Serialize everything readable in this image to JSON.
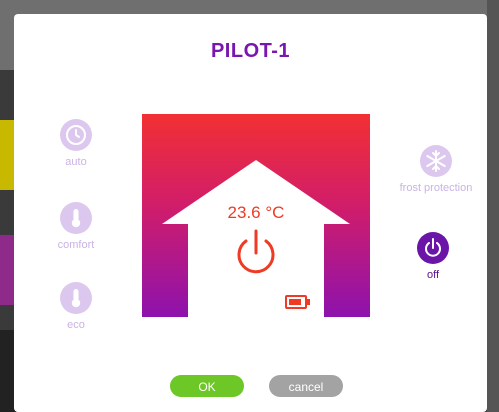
{
  "dialog": {
    "title": "PILOT-1"
  },
  "modes": {
    "auto": {
      "label": "auto",
      "icon": "clock-icon",
      "active": false
    },
    "comfort": {
      "label": "comfort",
      "icon": "thermometer-icon",
      "active": false
    },
    "eco": {
      "label": "eco",
      "icon": "thermometer-icon",
      "active": false
    },
    "frost": {
      "label": "frost protection",
      "icon": "snowflake-icon",
      "active": false
    },
    "off": {
      "label": "off",
      "icon": "power-icon",
      "active": true
    }
  },
  "status": {
    "temperature": "23.6 °C",
    "icons": [
      "house-icon",
      "power-icon",
      "battery-icon"
    ]
  },
  "buttons": {
    "ok": "OK",
    "cancel": "cancel"
  },
  "colors": {
    "title": "#7a16b0",
    "mode_active": "#6a14a8",
    "mode_inactive": "#dcc8ee",
    "gradient_top": "#f23033",
    "gradient_bottom": "#8d12ad",
    "accent_red": "#ef3a24",
    "ok_button": "#6dc727",
    "cancel_button": "#a3a3a3"
  }
}
